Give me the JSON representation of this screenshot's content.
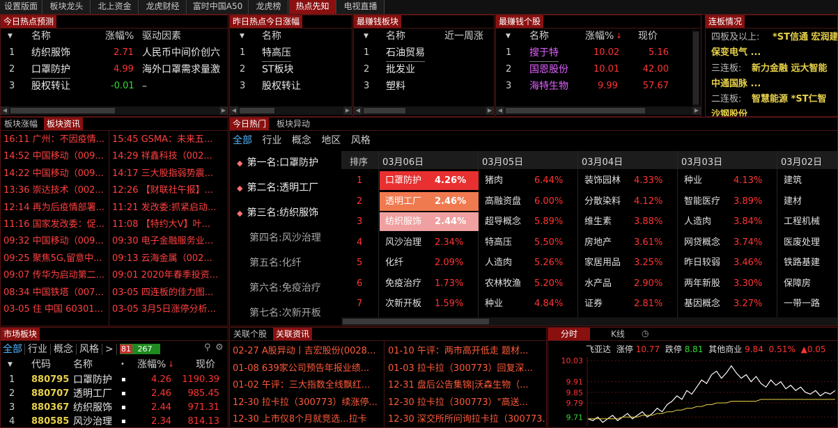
{
  "top_tabs": [
    {
      "label": "设置版面",
      "active": false
    },
    {
      "label": "板块龙头",
      "active": false
    },
    {
      "label": "北上资金",
      "active": false
    },
    {
      "label": "龙虎财经",
      "active": false
    },
    {
      "label": "富时中国A50",
      "active": false
    },
    {
      "label": "龙虎榜",
      "active": false
    },
    {
      "label": "热点先知",
      "active": true
    },
    {
      "label": "电视直播",
      "active": false
    }
  ],
  "hot_predict": {
    "title": "今日热点预测",
    "headers": {
      "name": "名称",
      "pct": "涨幅%",
      "driver": "驱动因素"
    },
    "rows": [
      {
        "idx": "1",
        "name": "纺织服饰",
        "pct": "2.71",
        "driver": "人民币中间价创六"
      },
      {
        "idx": "2",
        "name": "口罩防护",
        "pct": "4.99",
        "driver": "海外口罩需求量激"
      },
      {
        "idx": "3",
        "name": "股权转让",
        "pct": "-0.01",
        "driver": "–"
      }
    ]
  },
  "yesterday_hot": {
    "title": "昨日热点今日涨幅",
    "headers": {
      "name": "名称"
    },
    "rows": [
      {
        "idx": "1",
        "name": "特高压"
      },
      {
        "idx": "2",
        "name": "ST板块"
      },
      {
        "idx": "3",
        "name": "股权转让"
      }
    ]
  },
  "top_sectors": {
    "title": "最赚钱板块",
    "headers": {
      "name": "名称",
      "week": "近一周涨"
    },
    "rows": [
      {
        "idx": "1",
        "name": "石油贸易"
      },
      {
        "idx": "2",
        "name": "批发业"
      },
      {
        "idx": "3",
        "name": "塑料"
      }
    ]
  },
  "top_stocks": {
    "title": "最赚钱个股",
    "headers": {
      "name": "名称",
      "pct": "涨幅%",
      "price": "现价"
    },
    "rows": [
      {
        "idx": "1",
        "name": "搜于特",
        "pct": "10.02",
        "price": "5.16"
      },
      {
        "idx": "2",
        "name": "国恩股份",
        "pct": "10.01",
        "price": "42.00"
      },
      {
        "idx": "3",
        "name": "海特生物",
        "pct": "9.99",
        "price": "57.67"
      }
    ]
  },
  "limit_up": {
    "title": "连板情况",
    "lines": [
      {
        "label": "四板及以上:",
        "items": "*ST信通  宏润建"
      },
      {
        "label": "",
        "items": "保变电气    ..."
      },
      {
        "label": "三连板:",
        "items": "新力金融  远大智能"
      },
      {
        "label": "",
        "items": "中通国脉    ..."
      },
      {
        "label": "二连板:",
        "items": "智慧能源  *ST仁智"
      },
      {
        "label": "",
        "items": "沙钢股份"
      }
    ]
  },
  "news_tabs": [
    {
      "label": "板块涨幅",
      "active": false
    },
    {
      "label": "板块资讯",
      "active": true
    }
  ],
  "news_left": [
    "16:11 广州：不因疫情...",
    "14:52 中国移动（009...",
    "14:22 中国移动（009...",
    "13:36 崇达技术（002...",
    "12:14 再为后疫情部署...",
    "11:16 国家发改委：促...",
    "09:32 中国移动（009...",
    "09:25 聚焦5G,留意中...",
    "09:07 传华为启动第二...",
    "08:34 中国铁塔（007...",
    "03-05 住 中国 60301..."
  ],
  "news_right": [
    "15:45 GSMA：未来五...",
    "14:29 祥鑫科技（002...",
    "14:17 三大股指弱势震...",
    "12:26 【财联社午报】...",
    "11:21 发改委:抓紧启动...",
    "11:08 【特约大V】叶...",
    "09:30 电子金融服务业...",
    "09:13 云海金属（002...",
    "09:01 2020年春季投资...",
    "03-05 四连板的佳力图...",
    "03-05 3月5日涨停分析..."
  ],
  "hot_tabs": [
    {
      "label": "今日热门",
      "active": true
    },
    {
      "label": "板块异动",
      "active": false
    }
  ],
  "hot_filters": [
    {
      "label": "全部",
      "active": true
    },
    {
      "label": "行业",
      "active": false
    },
    {
      "label": "概念",
      "active": false
    },
    {
      "label": "地区",
      "active": false
    },
    {
      "label": "风格",
      "active": false
    }
  ],
  "ranking": [
    {
      "label": "第一名:口罩防护",
      "top": true
    },
    {
      "label": "第二名:透明工厂",
      "top": true
    },
    {
      "label": "第三名:纺织服饰",
      "top": true
    },
    {
      "label": "第四名:风沙治理",
      "top": false
    },
    {
      "label": "第五名:化纤",
      "top": false
    },
    {
      "label": "第六名:免疫治疗",
      "top": false
    },
    {
      "label": "第七名:次新开板",
      "top": false
    }
  ],
  "hot_table": {
    "idx_header": "排序",
    "dates": [
      "03月06日",
      "03月05日",
      "03月04日",
      "03月03日",
      "03月02日"
    ],
    "rows": [
      {
        "idx": "1",
        "cells": [
          [
            "口罩防护",
            "4.26%"
          ],
          [
            "猪肉",
            "6.44%"
          ],
          [
            "装饰园林",
            "4.33%"
          ],
          [
            "种业",
            "4.13%"
          ],
          [
            "建筑",
            ""
          ]
        ]
      },
      {
        "idx": "2",
        "cells": [
          [
            "透明工厂",
            "2.46%"
          ],
          [
            "高融资盘",
            "6.00%"
          ],
          [
            "分散染料",
            "4.12%"
          ],
          [
            "智能医疗",
            "3.89%"
          ],
          [
            "建材",
            ""
          ]
        ]
      },
      {
        "idx": "3",
        "cells": [
          [
            "纺织服饰",
            "2.44%"
          ],
          [
            "超导概念",
            "5.89%"
          ],
          [
            "维生素",
            "3.88%"
          ],
          [
            "人造肉",
            "3.84%"
          ],
          [
            "工程机械",
            ""
          ]
        ]
      },
      {
        "idx": "4",
        "cells": [
          [
            "风沙治理",
            "2.34%"
          ],
          [
            "特高压",
            "5.50%"
          ],
          [
            "房地产",
            "3.61%"
          ],
          [
            "网贷概念",
            "3.74%"
          ],
          [
            "医废处理",
            ""
          ]
        ]
      },
      {
        "idx": "5",
        "cells": [
          [
            "化纤",
            "2.09%"
          ],
          [
            "人造肉",
            "5.26%"
          ],
          [
            "家居用品",
            "3.25%"
          ],
          [
            "昨日较弱",
            "3.46%"
          ],
          [
            "铁路基建",
            ""
          ]
        ]
      },
      {
        "idx": "6",
        "cells": [
          [
            "免疫治疗",
            "1.73%"
          ],
          [
            "农林牧渔",
            "5.20%"
          ],
          [
            "水产品",
            "2.90%"
          ],
          [
            "两年新股",
            "3.30%"
          ],
          [
            "保障房",
            ""
          ]
        ]
      },
      {
        "idx": "7",
        "cells": [
          [
            "次新开板",
            "1.59%"
          ],
          [
            "种业",
            "4.84%"
          ],
          [
            "证券",
            "2.81%"
          ],
          [
            "基因概念",
            "3.27%"
          ],
          [
            "一带一路",
            ""
          ]
        ]
      }
    ],
    "highlight_colors": [
      "#e83030",
      "#f07a50",
      "#f0a0a0"
    ]
  },
  "market": {
    "title": "市场板块",
    "filters": [
      "全部",
      "行业",
      "概念",
      "风格",
      ">"
    ],
    "up_count": "81",
    "down_count": "267",
    "headers": {
      "code": "代码",
      "name": "名称",
      "pct": "涨幅%",
      "price": "现价"
    },
    "rows": [
      {
        "idx": "1",
        "code": "880795",
        "name": "口罩防护",
        "pct": "4.26",
        "price": "1190.39"
      },
      {
        "idx": "2",
        "code": "880707",
        "name": "透明工厂",
        "pct": "2.46",
        "price": "985.45"
      },
      {
        "idx": "3",
        "code": "880367",
        "name": "纺织服饰",
        "pct": "2.44",
        "price": "971.31"
      },
      {
        "idx": "4",
        "code": "880585",
        "name": "风沙治理",
        "pct": "2.34",
        "price": "814.13"
      }
    ]
  },
  "related_tabs": [
    {
      "label": "关联个股",
      "active": false
    },
    {
      "label": "关联资讯",
      "active": true
    }
  ],
  "related_left": [
    "02-27 A股异动丨吉宏股份(0028...",
    "01-08 639家公司预告年报业绩...",
    "01-02 午评：三大指数全线飘红...",
    "12-30 拉卡拉（300773）续涨停...",
    "12-30 上市仅8个月就竞选...拉卡"
  ],
  "related_right": [
    "01-10 午评：两市高开低走 题材...",
    "01-03 拉卡拉（300773）回复深...",
    "12-31 盘后公告集锦|沃森生物（...",
    "12-30 拉卡拉（300773）\"高送...",
    "12-30 深交所所问询拉卡拉（300773..."
  ],
  "chart_tabs": [
    {
      "label": "分时",
      "active": true
    },
    {
      "label": "K线",
      "active": false
    }
  ],
  "quote": {
    "name": "飞亚达",
    "limit_up_label": "涨停",
    "limit_up": "10.77",
    "limit_down_label": "跌停",
    "limit_down": "8.81",
    "other_label": "其他商业",
    "other_val": "9.84",
    "other_pct": "0.51%",
    "change": "▲0.05"
  },
  "chart_data": {
    "type": "line",
    "yticks": [
      "10.03",
      "9.91",
      "9.85",
      "9.79",
      "9.71"
    ],
    "ylim": [
      9.66,
      10.05
    ],
    "series": [
      {
        "values": [
          9.7,
          9.69,
          9.71,
          9.68,
          9.7,
          9.72,
          9.69,
          9.71,
          9.73,
          9.7,
          9.72,
          9.74,
          9.71,
          9.73,
          9.76,
          9.74,
          9.78,
          9.8,
          9.83,
          9.81,
          9.86,
          9.84,
          9.88,
          9.92,
          9.9,
          9.95,
          9.97,
          9.93,
          9.96,
          10.0,
          9.96,
          9.93,
          9.95,
          9.91,
          9.94,
          9.9,
          9.88,
          9.92,
          9.89,
          9.91,
          9.87,
          9.89,
          9.86,
          9.88,
          9.85,
          9.84,
          9.86,
          9.83,
          9.85,
          9.84,
          9.86
        ]
      },
      {
        "values": [
          9.7,
          9.7,
          9.7,
          9.7,
          9.7,
          9.7,
          9.7,
          9.71,
          9.71,
          9.71,
          9.71,
          9.72,
          9.72,
          9.72,
          9.73,
          9.73,
          9.74,
          9.74,
          9.75,
          9.75,
          9.76,
          9.76,
          9.77,
          9.77,
          9.78,
          9.78,
          9.79,
          9.79,
          9.79,
          9.8,
          9.8,
          9.8,
          9.8,
          9.8,
          9.8,
          9.81,
          9.81,
          9.81,
          9.81,
          9.81,
          9.81,
          9.81,
          9.81,
          9.81,
          9.81,
          9.81,
          9.81,
          9.81,
          9.81,
          9.81,
          9.81
        ]
      }
    ]
  }
}
